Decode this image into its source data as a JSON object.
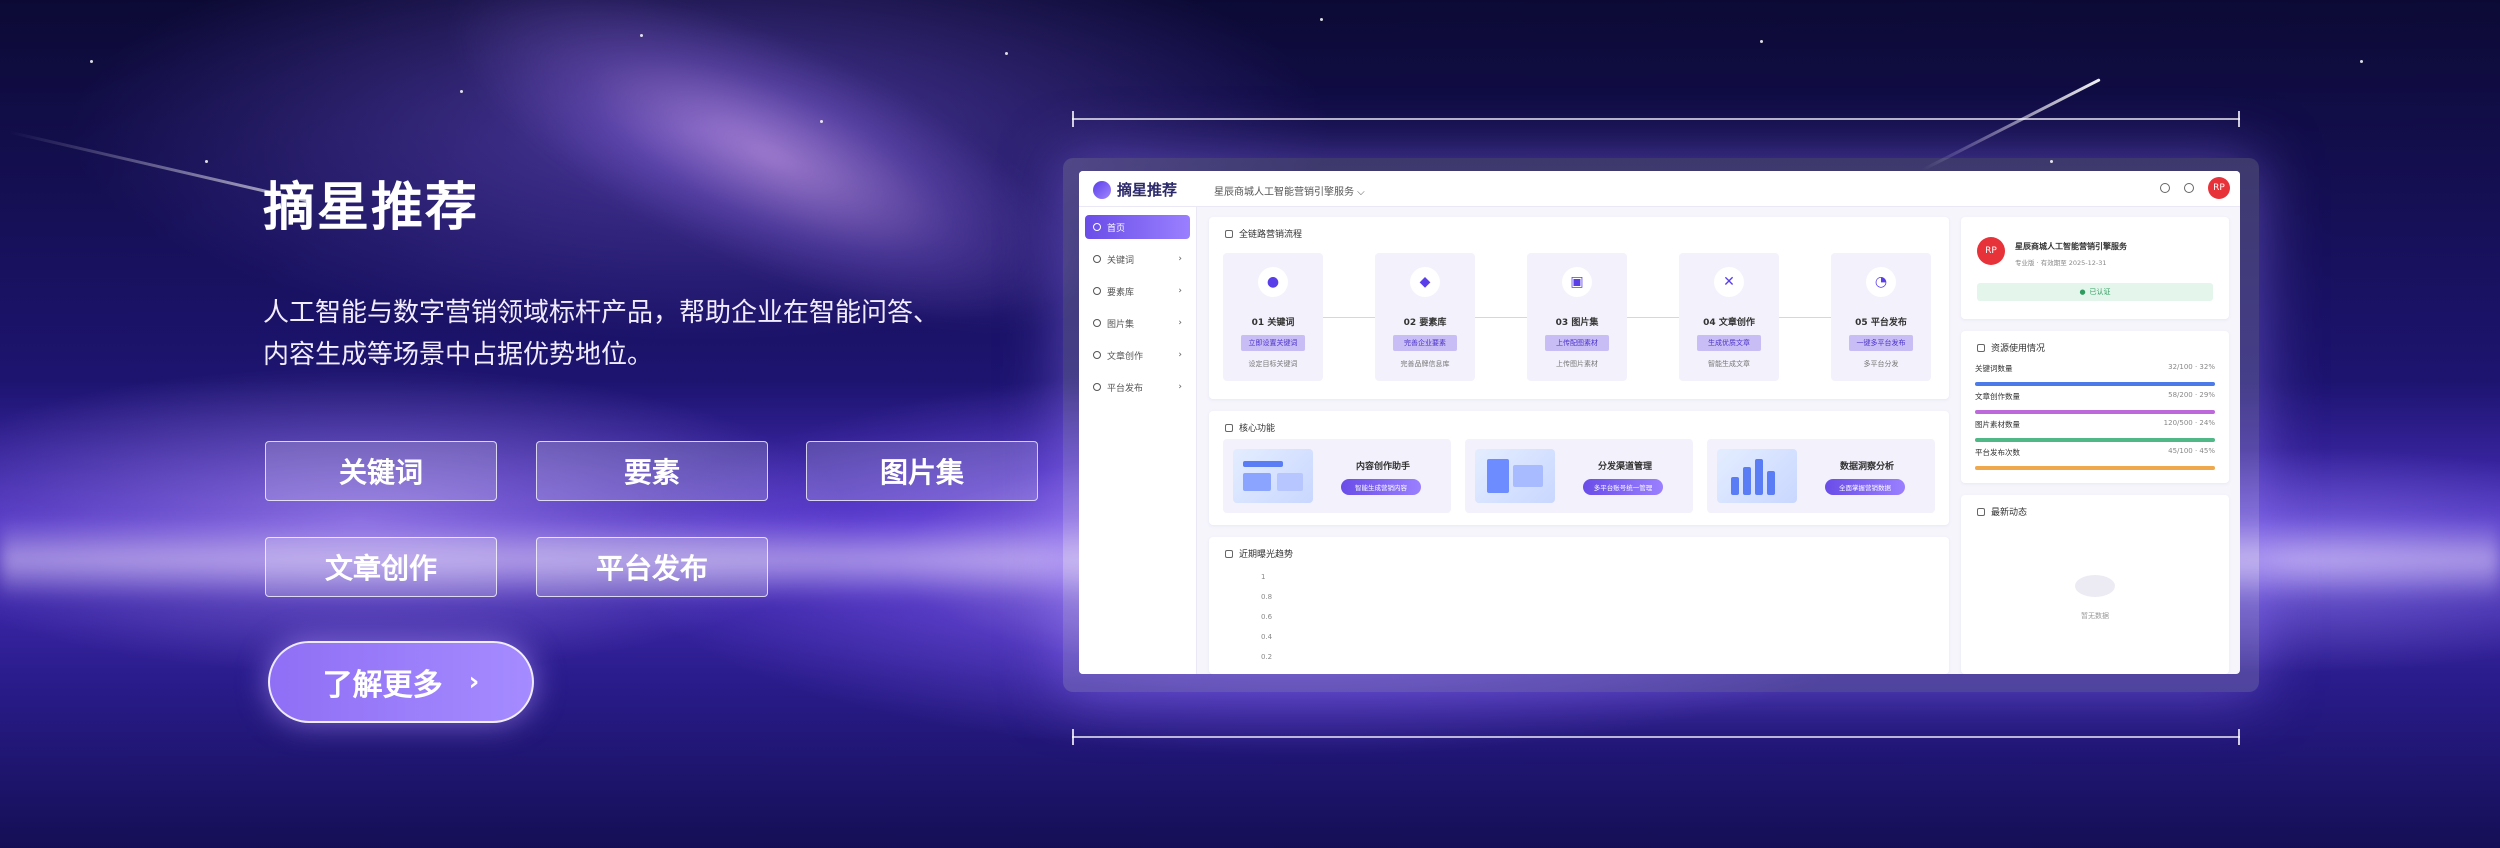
{
  "hero": {
    "title": "摘星推荐",
    "description_line1": "人工智能与数字营销领域标杆产品，帮助企业在智能问答、",
    "description_line2": "内容生成等场景中占据优势地位。",
    "chips": [
      "关键词",
      "要素",
      "图片集",
      "文章创作",
      "平台发布"
    ],
    "more_button": "了解更多",
    "more_icon": "chevron-right-icon"
  },
  "dashboard": {
    "logo_text": "摘星推荐",
    "breadcrumb": "星辰商城人工智能营销引擎服务 ⌵",
    "avatar_text": "RP",
    "sidebar": [
      {
        "label": "首页",
        "active": true
      },
      {
        "label": "关键词",
        "active": false
      },
      {
        "label": "要素库",
        "active": false
      },
      {
        "label": "图片集",
        "active": false
      },
      {
        "label": "文章创作",
        "active": false
      },
      {
        "label": "平台发布",
        "active": false
      }
    ],
    "process": {
      "title": "全链路营销流程",
      "steps": [
        {
          "name": "01 关键词",
          "pill": "立即设置关键词",
          "note": "设定目标关键词"
        },
        {
          "name": "02 要素库",
          "pill": "完善企业要素",
          "note": "完善品牌信息库"
        },
        {
          "name": "03 图片集",
          "pill": "上传配图素材",
          "note": "上传图片素材"
        },
        {
          "name": "04 文章创作",
          "pill": "生成优质文章",
          "note": "智能生成文章"
        },
        {
          "name": "05 平台发布",
          "pill": "一键多平台发布",
          "note": "多平台分发"
        }
      ]
    },
    "features": {
      "title": "核心功能",
      "items": [
        {
          "name": "内容创作助手",
          "button": "智能生成营销内容"
        },
        {
          "name": "分发渠道管理",
          "button": "多平台账号统一管理"
        },
        {
          "name": "数据洞察分析",
          "button": "全面掌握营销数据"
        }
      ]
    },
    "trend": {
      "title": "近期曝光趋势",
      "axis": [
        "1",
        "0.8",
        "0.6",
        "0.4",
        "0.2"
      ]
    },
    "profile": {
      "avatar_text": "RP",
      "name": "星辰商城人工智能营销引擎服务",
      "subtitle": "专业版 · 有效期至 2025-12-31",
      "status": "已认证"
    },
    "quota": {
      "title": "资源使用情况",
      "rows": [
        {
          "label": "关键词数量",
          "value": "32/100 · 32%",
          "color": "#3b6ee8",
          "fill": 0.32
        },
        {
          "label": "文章创作数量",
          "value": "58/200 · 29%",
          "color": "#b85ad8",
          "fill": 0.29
        },
        {
          "label": "图片素材数量",
          "value": "120/500 · 24%",
          "color": "#3fb27a",
          "fill": 0.24
        },
        {
          "label": "平台发布次数",
          "value": "45/100 · 45%",
          "color": "#f0a23a",
          "fill": 0.45
        }
      ]
    },
    "notice": {
      "title": "最新动态",
      "empty": "暂无数据"
    }
  }
}
